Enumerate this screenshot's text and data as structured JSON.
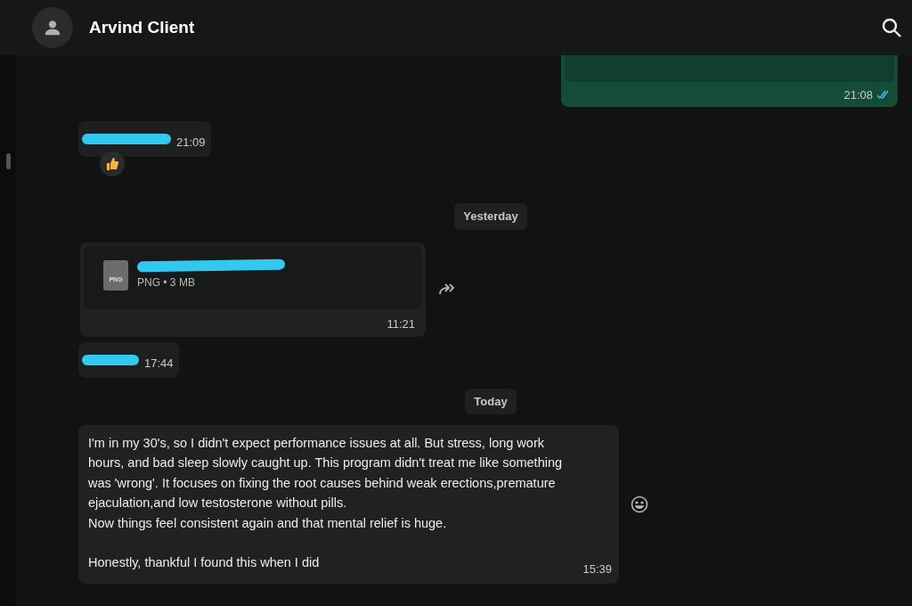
{
  "header": {
    "title": "Arvind Client"
  },
  "messages": [
    {
      "kind": "sent_file",
      "time": "21:08",
      "read": true
    },
    {
      "kind": "redacted",
      "time": "21:09",
      "reacted": true
    },
    {
      "kind": "date",
      "label": "Yesterday"
    },
    {
      "kind": "file",
      "meta": "PNG • 3 MB",
      "file_type": "PNG",
      "time": "11:21",
      "forward": true
    },
    {
      "kind": "redacted",
      "time": "17:44",
      "reacted": false
    },
    {
      "kind": "date",
      "label": "Today"
    },
    {
      "kind": "text",
      "paragraphs": [
        "I'm in my 30's, so I didn't expect performance issues at all. But stress, long work hours, and bad sleep slowly caught up. This program didn't treat me like something was 'wrong'. It focuses on fixing the root causes behind weak erections,premature ejaculation,and low testosterone without pills.\nNow things feel consistent again and that mental relief is huge.",
        "Honestly, thankful I found this when I did"
      ],
      "time": "15:39",
      "emoji_button": true
    }
  ]
}
